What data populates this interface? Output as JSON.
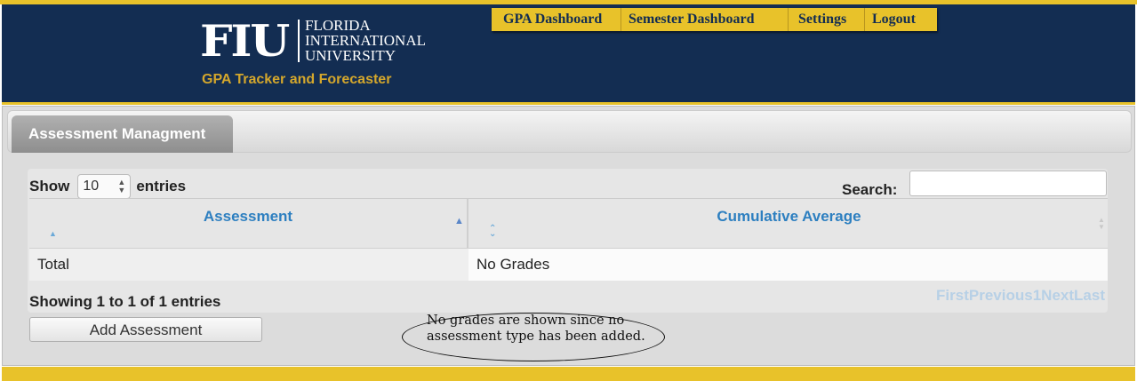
{
  "header": {
    "logo_abbr": "FIU",
    "logo_line1": "FLORIDA",
    "logo_line2": "INTERNATIONAL",
    "logo_line3": "UNIVERSITY",
    "subtitle": "GPA Tracker and Forecaster",
    "nav": [
      "GPA Dashboard",
      "Semester Dashboard",
      "Settings",
      "Logout"
    ]
  },
  "tab": {
    "label": "Assessment Managment"
  },
  "table": {
    "show_label": "Show",
    "page_size": "10",
    "entries_label": "entries",
    "search_label": "Search:",
    "search_value": "",
    "columns": [
      "Assessment",
      "Cumulative Average"
    ],
    "rows": [
      [
        "Total",
        "No Grades"
      ]
    ],
    "info": "Showing 1 to 1 of 1 entries",
    "paging": [
      "First",
      "Previous",
      "1",
      "Next",
      "Last"
    ]
  },
  "add_button": "Add Assessment",
  "note": {
    "line1": "No grades are shown since no",
    "line2": "assessment type has been added."
  },
  "colors": {
    "navy": "#132d52",
    "gold": "#e8c22a",
    "link": "#2d7fc0"
  }
}
